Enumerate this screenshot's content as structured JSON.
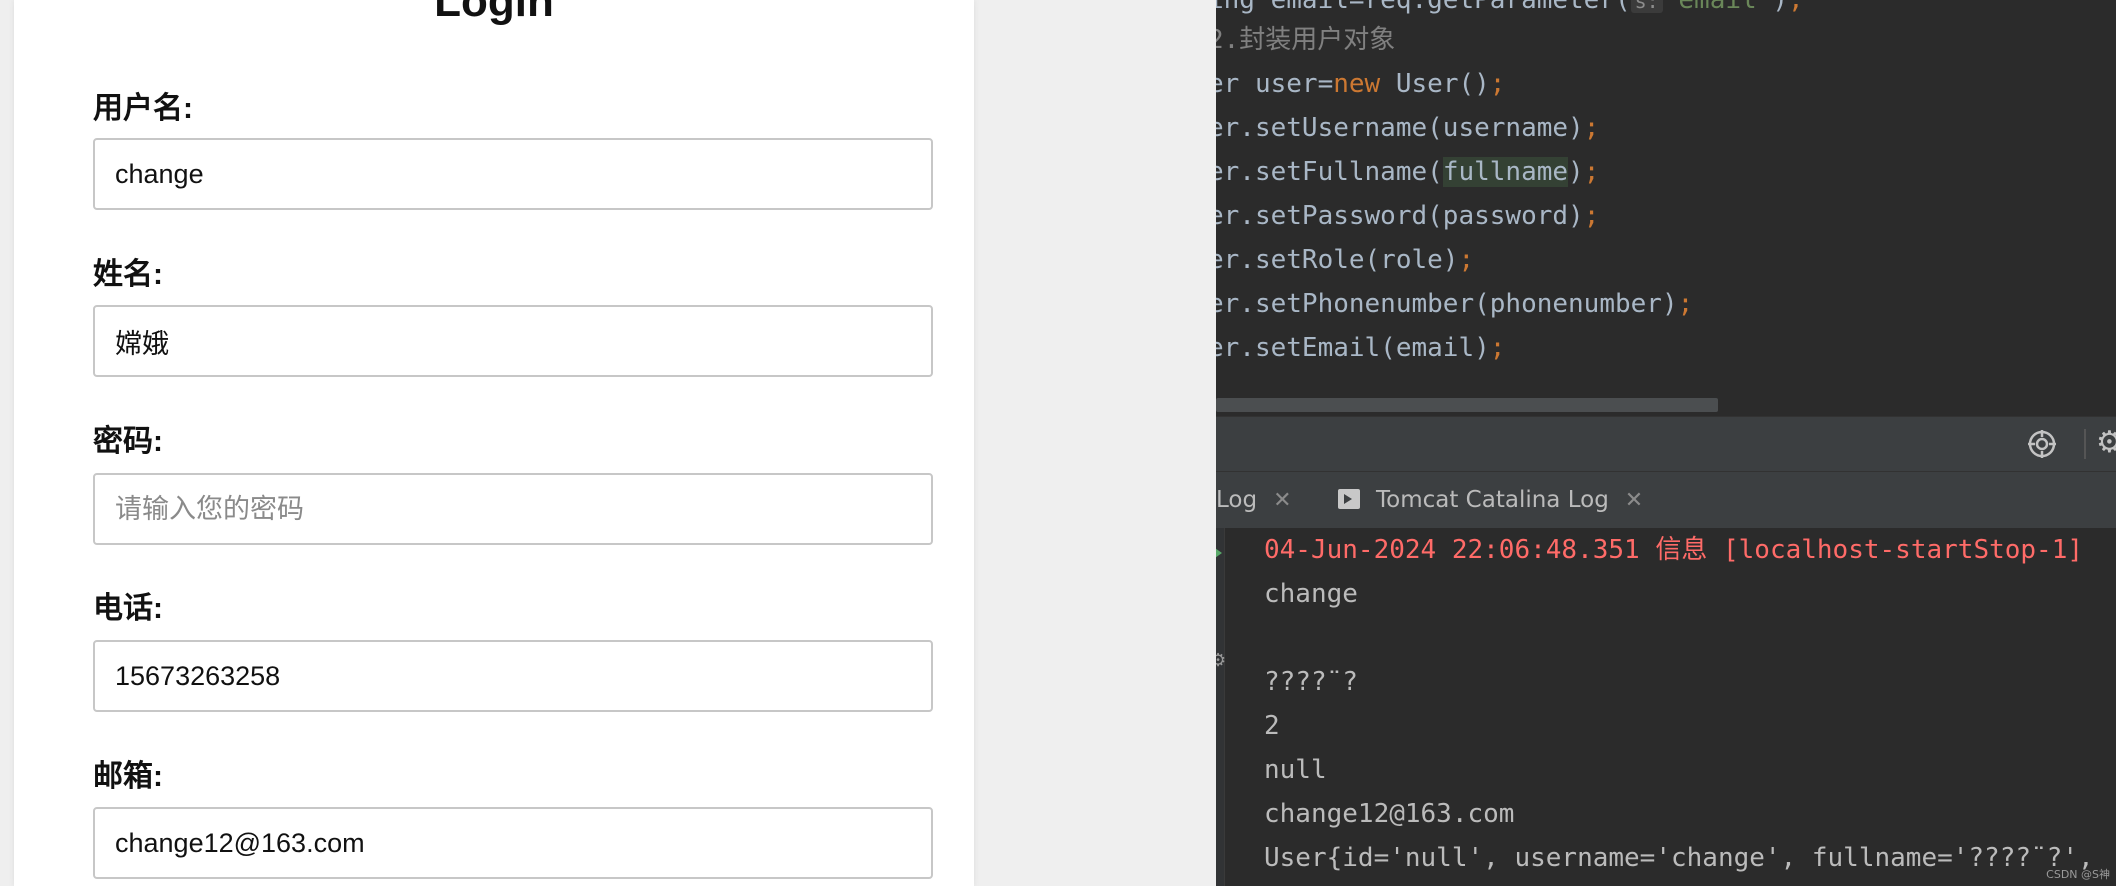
{
  "form": {
    "title": "Login",
    "fields": [
      {
        "label": "用户名:",
        "value": "change",
        "placeholder": ""
      },
      {
        "label": "姓名:",
        "value": "嫦娥",
        "placeholder": ""
      },
      {
        "label": "密码:",
        "value": "",
        "placeholder": "请输入您的密码"
      },
      {
        "label": "电话:",
        "value": "15673263258",
        "placeholder": ""
      },
      {
        "label": "邮箱:",
        "value": "change12@163.com",
        "placeholder": ""
      }
    ]
  },
  "editor": {
    "line0": {
      "pre": "ing email=req.getParameter(",
      "hint": "s:",
      "str": "\"email\"",
      "post": ")",
      "semi": ";"
    },
    "line1": {
      "comment": "2.封装用户对象"
    },
    "line2": {
      "a": "er user=",
      "kw": "new",
      "b": " User()",
      "semi": ";"
    },
    "line3": {
      "text": "er.setUsername(username)",
      "semi": ";"
    },
    "line4": {
      "a": "er.setFullname(",
      "hl": "fullname",
      "b": ")",
      "semi": ";"
    },
    "line5": {
      "text": "er.setPassword(password)",
      "semi": ";"
    },
    "line6": {
      "text": "er.setRole(role)",
      "semi": ";"
    },
    "line7": {
      "text": "er.setPhonenumber(phonenumber)",
      "semi": ";"
    },
    "line8": {
      "text": "er.setEmail(email)",
      "semi": ";"
    }
  },
  "tabs": [
    {
      "label": "Log"
    },
    {
      "label": "Tomcat Catalina Log"
    }
  ],
  "console": {
    "lines": [
      "04-Jun-2024 22:06:48.351 信息 [localhost-startStop-1]",
      "change",
      "",
      "????¨?",
      "2",
      "null",
      "change12@163.com",
      "User{id='null', username='change', fullname='????¨?',"
    ]
  },
  "watermark": "CSDN @S神",
  "icons": {
    "target": "target-icon",
    "gear": "gear-icon",
    "close": "close-icon",
    "run": "run-icon"
  },
  "colors": {
    "editor_bg": "#2b2b2b",
    "keyword": "#cc7832",
    "error_text": "#ff6b68",
    "form_bg": "#ffffff"
  }
}
